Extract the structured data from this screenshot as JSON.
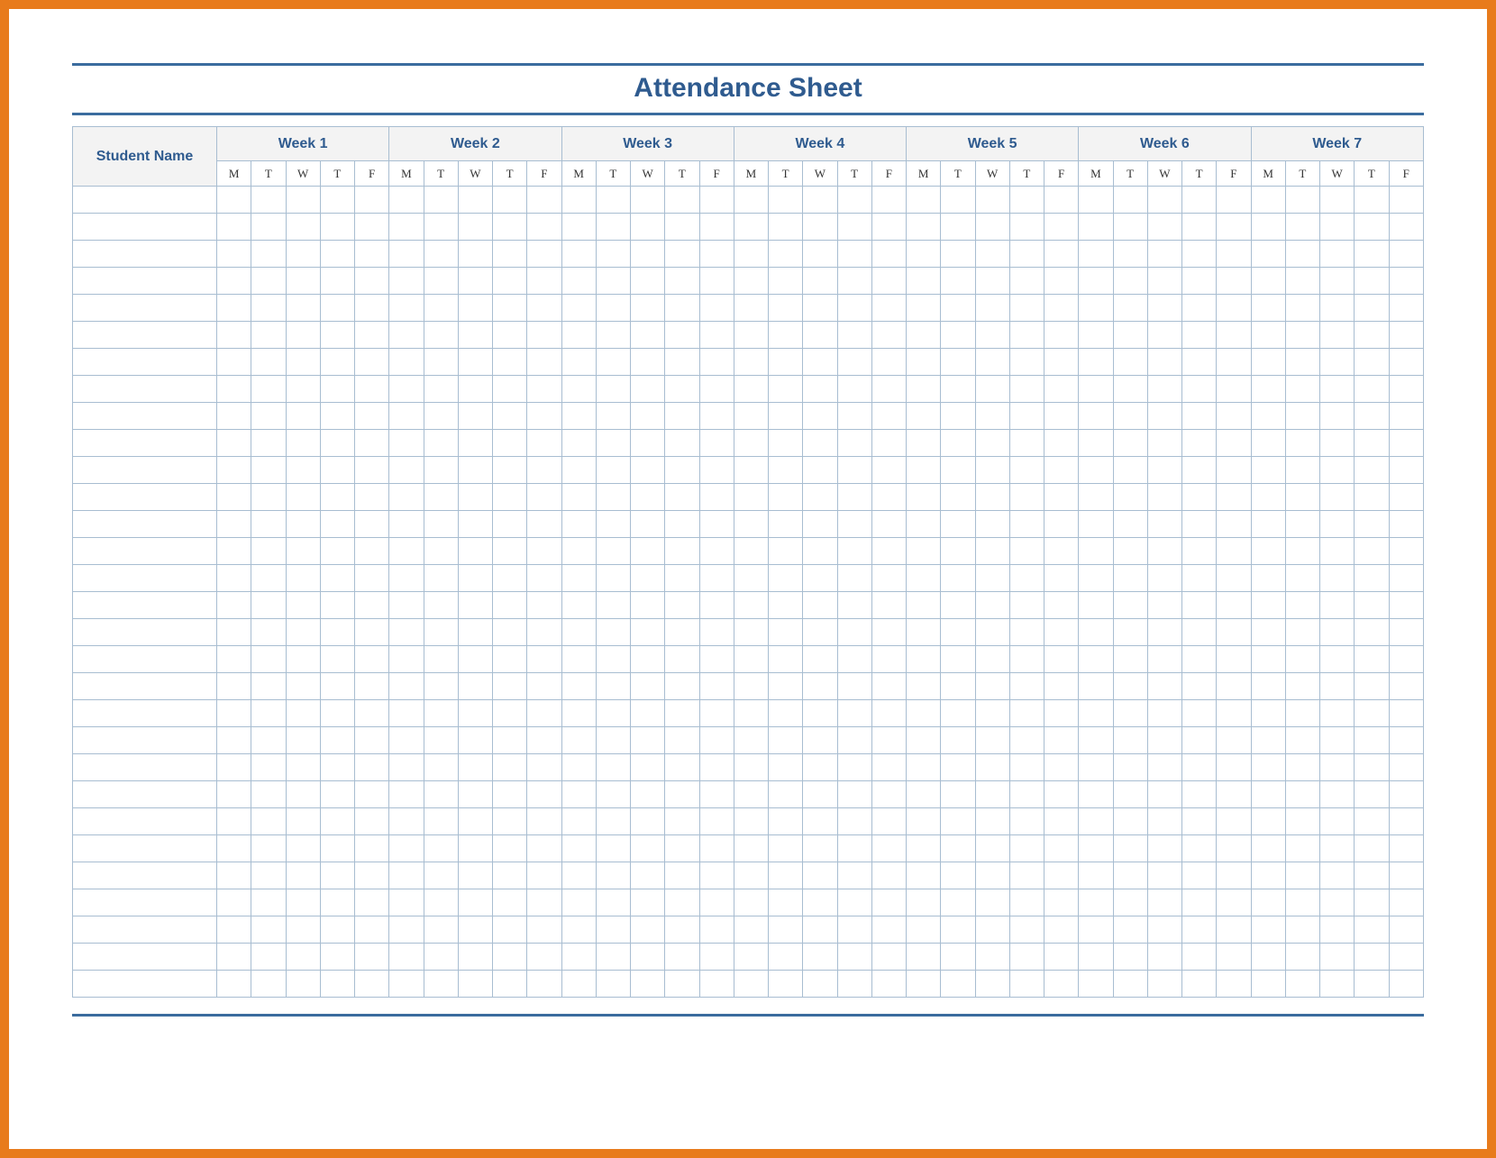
{
  "title": "Attendance Sheet",
  "name_header": "Student Name",
  "weeks": [
    "Week 1",
    "Week 2",
    "Week 3",
    "Week 4",
    "Week 5",
    "Week 6",
    "Week 7"
  ],
  "days": [
    "M",
    "T",
    "W",
    "T",
    "F"
  ],
  "row_count": 30
}
